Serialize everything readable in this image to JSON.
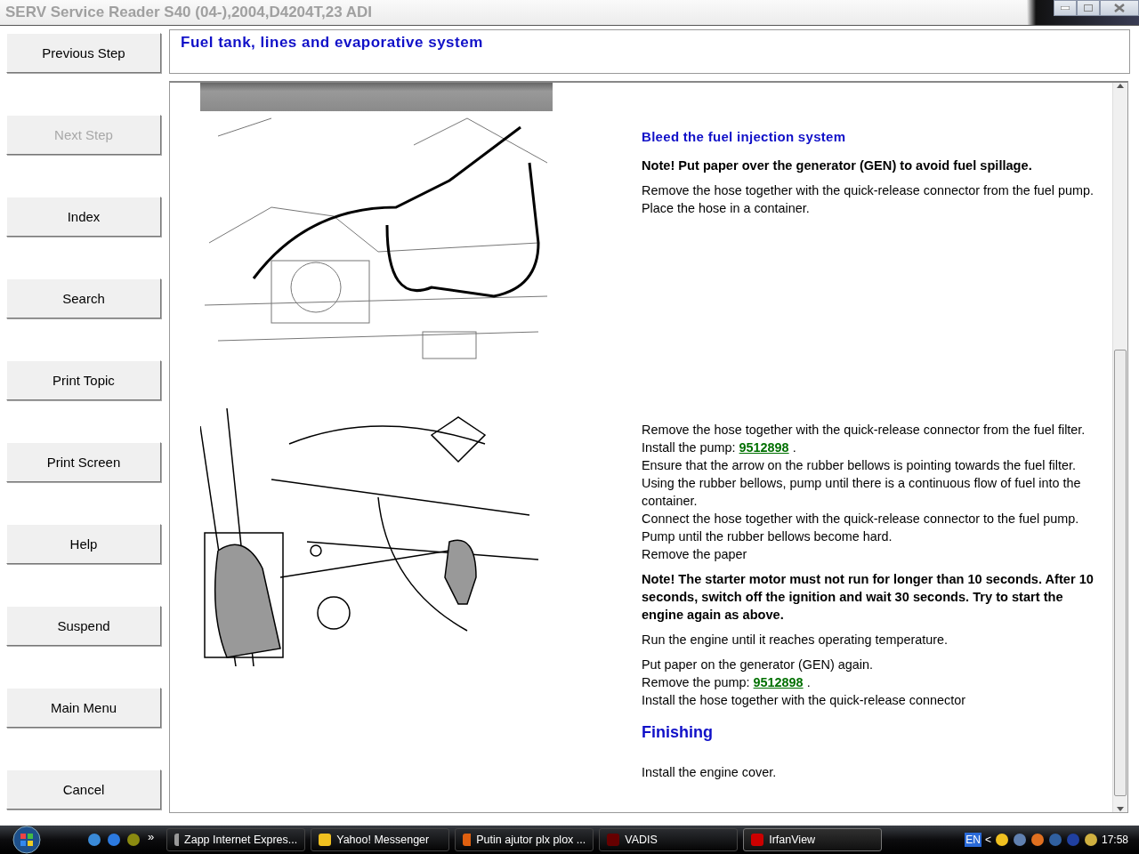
{
  "window": {
    "title": "SERV Service Reader S40 (04-),2004,D4204T,23 ADI"
  },
  "sidebar": {
    "buttons": [
      {
        "label": "Previous Step",
        "disabled": false
      },
      {
        "label": "Next Step",
        "disabled": true
      },
      {
        "label": "Index",
        "disabled": false
      },
      {
        "label": "Search",
        "disabled": false
      },
      {
        "label": "Print Topic",
        "disabled": false
      },
      {
        "label": "Print Screen",
        "disabled": false
      },
      {
        "label": "Help",
        "disabled": false
      },
      {
        "label": "Suspend",
        "disabled": false
      },
      {
        "label": "Main Menu",
        "disabled": false
      },
      {
        "label": "Cancel",
        "disabled": false
      }
    ]
  },
  "header": {
    "title": "Fuel tank, lines and evaporative system"
  },
  "sections": [
    {
      "blocks": [
        {
          "kind": "heading",
          "text": "Bleed the fuel injection system"
        },
        {
          "kind": "note",
          "text": "Note! Put paper over the generator (GEN) to avoid fuel spillage."
        },
        {
          "kind": "steps",
          "lines": [
            {
              "text": "Remove the hose together with the quick-release connector from the fuel pump. Place the hose in a container."
            }
          ]
        }
      ]
    },
    {
      "blocks": [
        {
          "kind": "steps",
          "lines": [
            {
              "text": "Remove the hose together with the quick-release connector from the fuel filter. Install the pump:",
              "link": "9512898",
              "tail": "."
            },
            {
              "text": "Ensure that the arrow on the rubber bellows is pointing towards the fuel filter."
            },
            {
              "text": "Using the rubber bellows, pump until there is a continuous flow of fuel into the container."
            },
            {
              "text": "Connect the hose together with the quick-release connector to the fuel pump."
            },
            {
              "text": "Pump until the rubber bellows become hard."
            },
            {
              "text": "Remove the paper"
            }
          ]
        },
        {
          "kind": "note",
          "text": "Note! The starter motor must not run for longer than 10 seconds. After 10 seconds, switch off the ignition and wait 30 seconds. Try to start the engine again as above."
        },
        {
          "kind": "steps",
          "lines": [
            {
              "text": "Run the engine until it reaches operating temperature."
            }
          ]
        },
        {
          "kind": "steps",
          "lines": [
            {
              "text": "Put paper on the generator (GEN) again."
            },
            {
              "text": "Remove the pump:",
              "link": "9512898",
              "tail": "."
            },
            {
              "text": "Install the hose together with the quick-release connector"
            }
          ]
        },
        {
          "kind": "subheading",
          "text": "Finishing"
        },
        {
          "kind": "steps",
          "lines": [
            {
              "text": "Install the engine cover."
            }
          ]
        }
      ]
    }
  ],
  "taskbar": {
    "overflow": "»",
    "tasks": [
      {
        "label": "Zapp Internet Expres...",
        "selected": false
      },
      {
        "label": "Yahoo! Messenger",
        "selected": false
      },
      {
        "label": "Putin ajutor plx plox ...",
        "selected": false
      },
      {
        "label": "VADIS",
        "selected": false
      },
      {
        "label": "IrfanView",
        "selected": true
      }
    ],
    "language": "EN",
    "tray_toggle": "<",
    "clock": "17:58"
  }
}
